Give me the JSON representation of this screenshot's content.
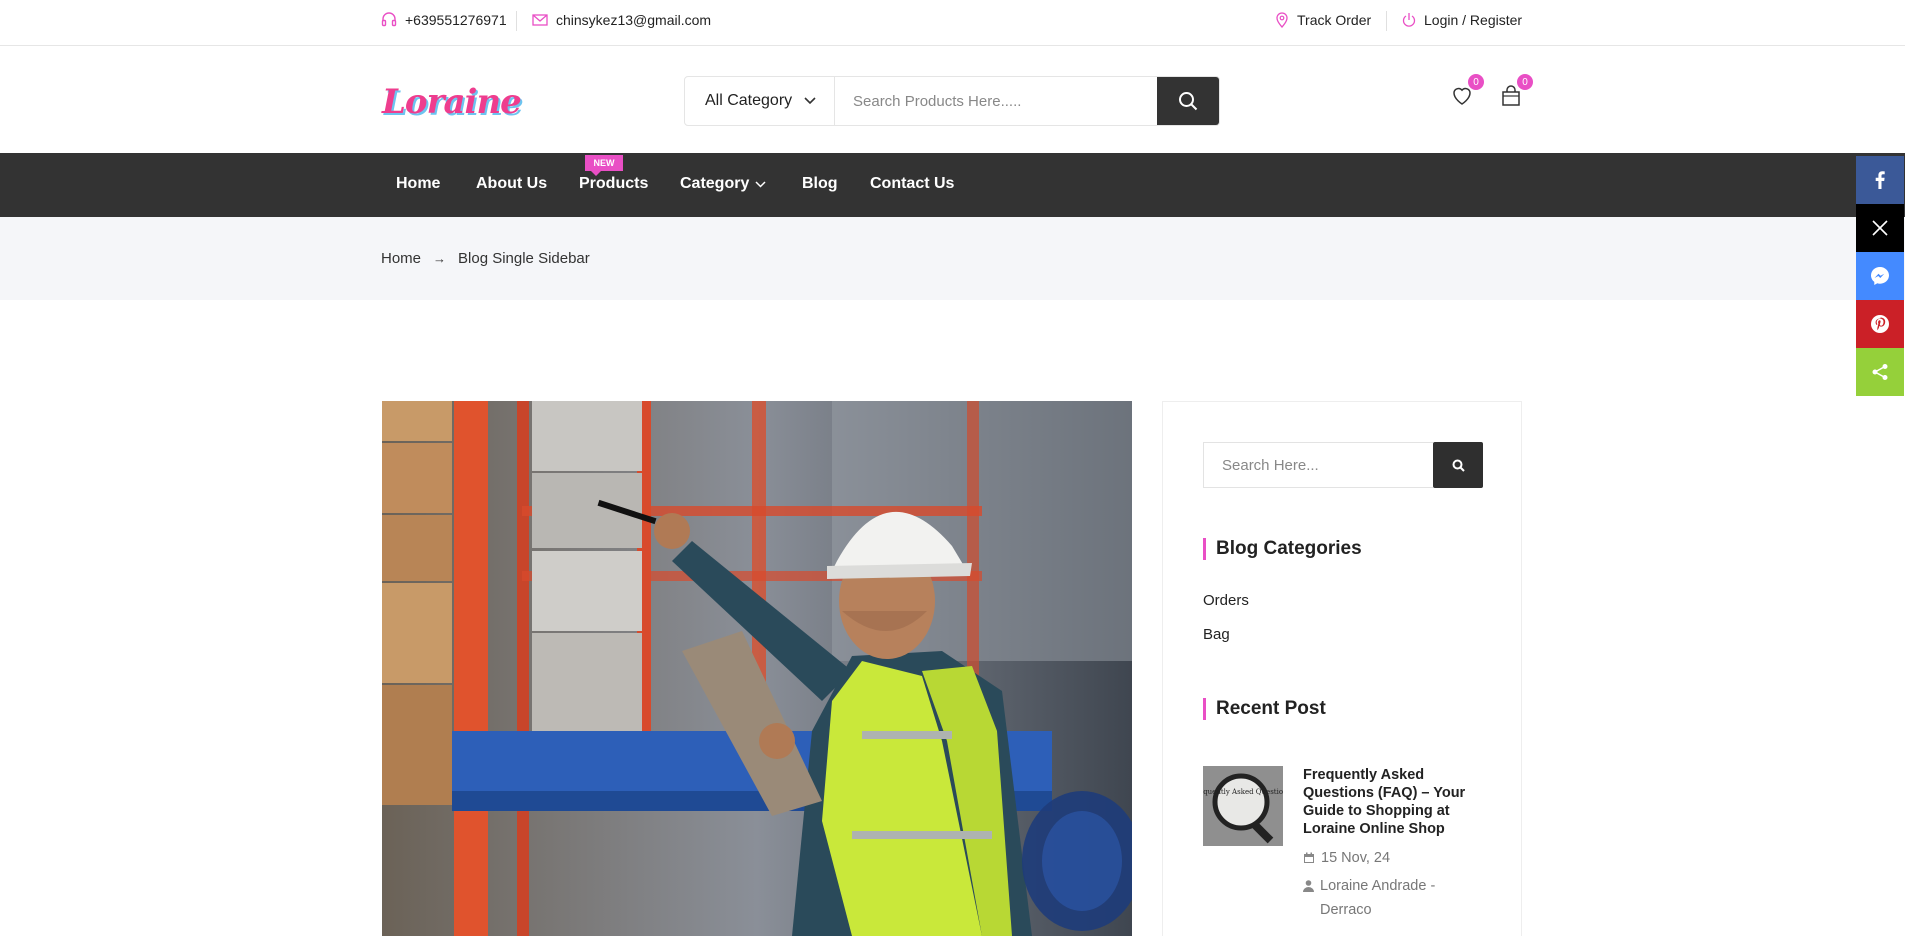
{
  "topbar": {
    "phone": "+639551276971",
    "email": "chinsykez13@gmail.com",
    "track_order": "Track Order",
    "login": "Login / Register"
  },
  "header": {
    "logo_text": "Loraine",
    "search_category": "All Category",
    "search_placeholder": "Search Products Here.....",
    "wishlist_count": "0",
    "cart_count": "0"
  },
  "nav": {
    "items": [
      "Home",
      "About Us",
      "Products",
      "Category",
      "Blog",
      "Contact Us"
    ],
    "new_badge": "NEW"
  },
  "breadcrumb": {
    "home": "Home",
    "current": "Blog Single Sidebar"
  },
  "sidebar": {
    "search_placeholder": "Search Here...",
    "categories_title": "Blog Categories",
    "categories": [
      "Orders",
      "Bag"
    ],
    "recent_title": "Recent Post",
    "recent_post": {
      "title": "Frequently Asked Questions (FAQ) – Your Guide to Shopping at Loraine Online Shop",
      "date": "15 Nov, 24",
      "author": "Loraine Andrade - Derraco",
      "thumb_text": "Frequently Asked Questions"
    }
  },
  "share": {
    "buttons": [
      "facebook",
      "x",
      "messenger",
      "pinterest",
      "share"
    ],
    "colors": {
      "facebook": "#3b5998",
      "x": "#000000",
      "messenger": "#448aff",
      "pinterest": "#cb2027",
      "share": "#95d03a"
    }
  },
  "colors": {
    "accent": "#e94fc5",
    "nav_bg": "#333333",
    "breadcrumb_bg": "#f5f6f9"
  }
}
